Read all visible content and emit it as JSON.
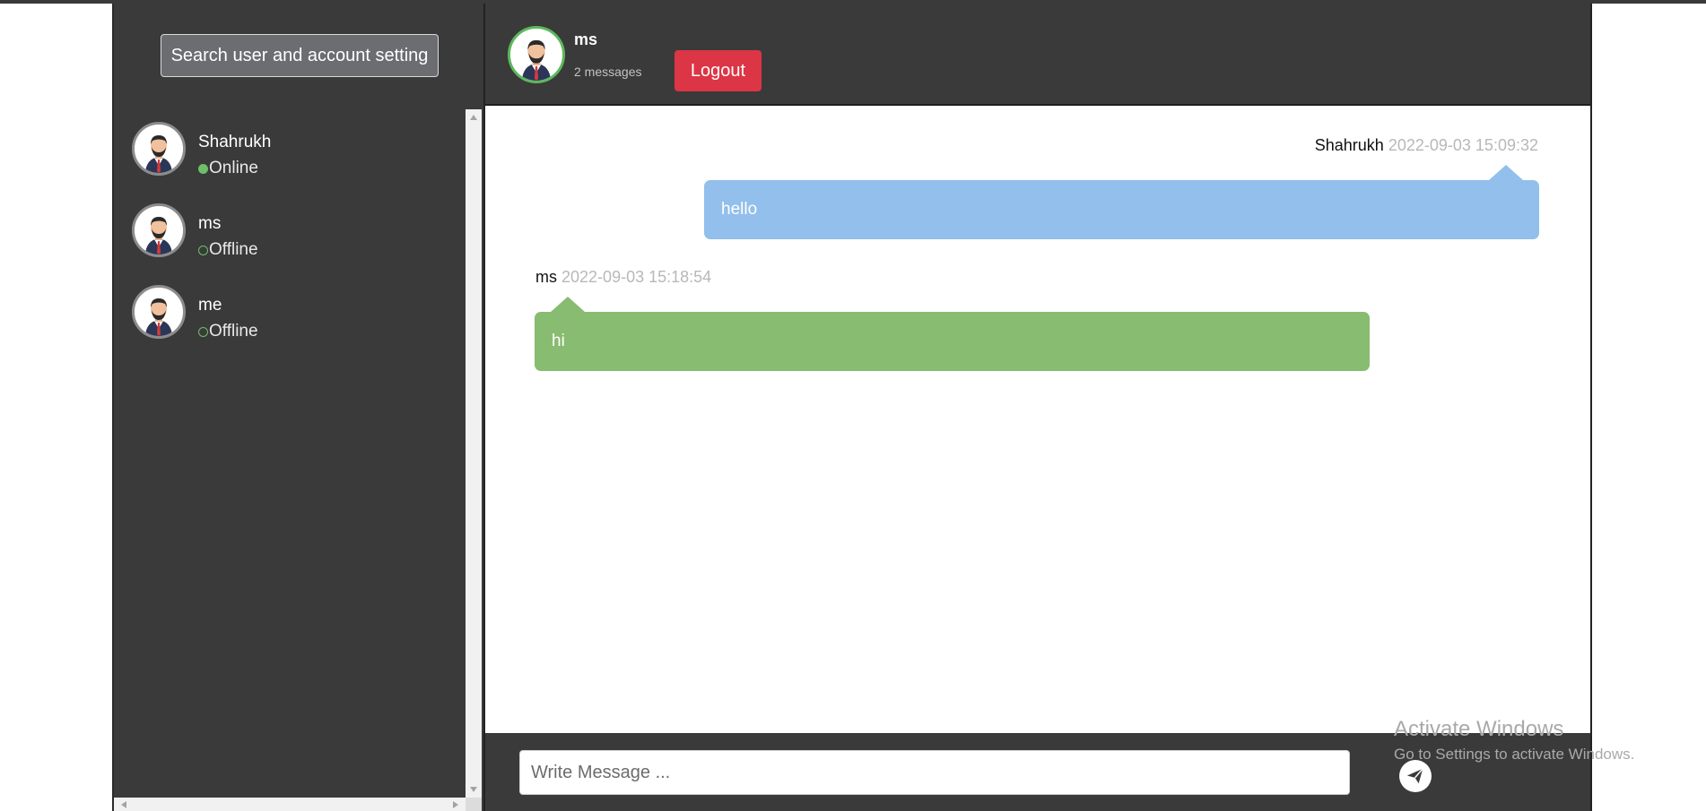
{
  "sidebar": {
    "search_button_label": "Search user and account setting",
    "contacts": [
      {
        "name": "Shahrukh",
        "status": "Online",
        "online": true
      },
      {
        "name": "ms",
        "status": "Offline",
        "online": false
      },
      {
        "name": "me",
        "status": "Offline",
        "online": false
      }
    ]
  },
  "chat": {
    "header": {
      "name": "ms",
      "message_count": "2 messages",
      "logout_label": "Logout"
    },
    "messages": [
      {
        "sender": "Shahrukh",
        "time": "2022-09-03 15:09:32",
        "text": "hello",
        "direction": "outgoing"
      },
      {
        "sender": "ms",
        "time": "2022-09-03 15:18:54",
        "text": "hi",
        "direction": "incoming"
      }
    ],
    "input": {
      "placeholder": "Write Message ..."
    }
  },
  "watermark": {
    "title": "Activate Windows",
    "subtitle": "Go to Settings to activate Windows."
  },
  "colors": {
    "panel": "#3a3a3a",
    "outgoing_bubble": "#92bfeb",
    "incoming_bubble": "#88bc71",
    "logout": "#dc3545",
    "online": "#6dbf67"
  },
  "icons": [
    "user-avatar-icon",
    "online-dot-icon",
    "offline-dot-icon",
    "send-icon"
  ]
}
